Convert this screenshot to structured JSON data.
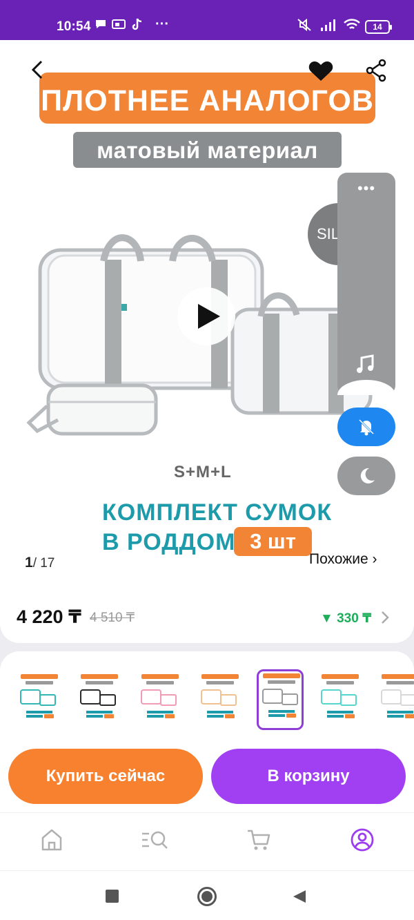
{
  "status_bar": {
    "time": "10:54",
    "battery": "14",
    "icons": [
      "chat-icon",
      "cast-icon",
      "tiktok-icon",
      "more-dots-icon",
      "mute-icon",
      "signal-icon",
      "wifi-icon",
      "battery-icon"
    ]
  },
  "product": {
    "banner_title": "ПЛОТНЕЕ АНАЛОГОВ",
    "banner_subtitle": "матовый материал",
    "sizes_label": "S+M+L",
    "promo_line1": "КОМПЛЕКТ СУМОК",
    "promo_line2": "В РОДДОМ",
    "promo_badge": "3 шт",
    "image_counter_current": "1",
    "image_counter_total": "/ 17",
    "similar_link": "Похожие ›",
    "brand_partial": "SIL",
    "price": "4 220 ₸",
    "old_price": "4 510 ₸",
    "discount": "▼ 330 ₸"
  },
  "thumbnails": [
    {
      "color": "#33b7b3",
      "selected": false
    },
    {
      "color": "#2a2a2a",
      "selected": false
    },
    {
      "color": "#f29bb5",
      "selected": false
    },
    {
      "color": "#f0c090",
      "selected": false
    },
    {
      "color": "#9a9a9a",
      "selected": true
    },
    {
      "color": "#55d5cc",
      "selected": false
    },
    {
      "color": "#d8d8d8",
      "selected": false
    }
  ],
  "actions": {
    "buy_now": "Купить сейчас",
    "add_to_cart": "В корзину"
  },
  "bottom_nav": [
    "home-icon",
    "catalog-search-icon",
    "cart-icon",
    "profile-icon"
  ],
  "colors": {
    "status_bar": "#6a22b6",
    "orange": "#f7812f",
    "purple": "#a13ff3",
    "teal": "#1d9bab",
    "green_discount": "#1cae5a"
  }
}
